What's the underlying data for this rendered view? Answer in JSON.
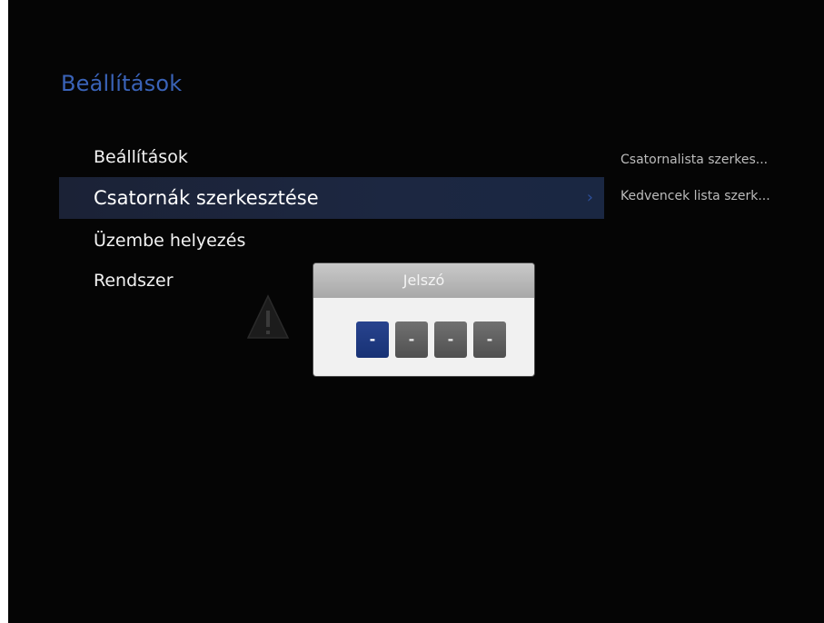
{
  "screen": {
    "title": "Beállítások"
  },
  "menu": {
    "items": [
      {
        "label": "Beállítások"
      },
      {
        "label": "Csatornák szerkesztése",
        "selected": true,
        "chevron": "›"
      },
      {
        "label": "Üzembe helyezés"
      },
      {
        "label": "Rendszer"
      }
    ]
  },
  "submenu": {
    "items": [
      {
        "label": "Csatornalista szerkes..."
      },
      {
        "label": "Kedvencek lista szerk..."
      }
    ]
  },
  "dialog": {
    "title": "Jelszó",
    "pin": [
      "-",
      "-",
      "-",
      "-"
    ],
    "active_index": 0
  },
  "icons": {
    "warning": "warning-triangle-icon",
    "chevron": "chevron-right-icon"
  },
  "colors": {
    "accent": "#3a63b8",
    "pin_active": "#1e3a82",
    "pin_inactive": "#5e5e5e",
    "background": "#050505"
  }
}
